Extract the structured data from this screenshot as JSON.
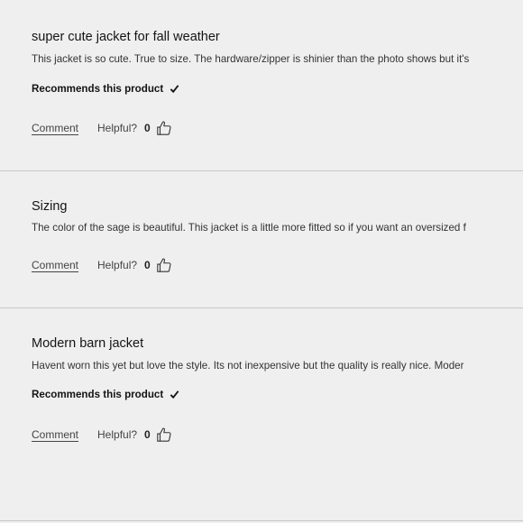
{
  "reviews": [
    {
      "title": "super cute jacket for fall weather",
      "body": "This jacket is so cute. True to size. The hardware/zipper is shinier than the photo shows but it's",
      "recommends": "Recommends this product",
      "comment": "Comment",
      "helpful_label": "Helpful?",
      "helpful_count": "0"
    },
    {
      "title": "Sizing",
      "body": "The color of the sage is beautiful. This jacket is a little more fitted so if you want an oversized f",
      "recommends": "",
      "comment": "Comment",
      "helpful_label": "Helpful?",
      "helpful_count": "0"
    },
    {
      "title": "Modern barn jacket",
      "body": "Havent worn this yet but love the style. Its not inexpensive but the quality is really nice. Moder",
      "recommends": "Recommends this product",
      "comment": "Comment",
      "helpful_label": "Helpful?",
      "helpful_count": "0"
    }
  ],
  "colors": {
    "background": "#efefef",
    "divider": "#c8c8c8",
    "text": "#1b1b1b"
  },
  "icons": {
    "check": "check-icon",
    "thumb": "thumbs-up-icon"
  }
}
